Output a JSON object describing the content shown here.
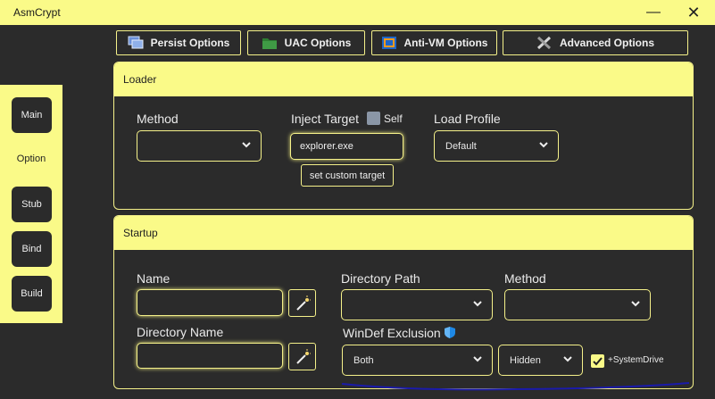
{
  "window": {
    "title": "AsmCrypt",
    "minimize_glyph": "—",
    "close_glyph": "✕"
  },
  "top_tabs": [
    {
      "label": "Persist Options",
      "icon": "window-stack-icon"
    },
    {
      "label": "UAC Options",
      "icon": "green-folder-icon"
    },
    {
      "label": "Anti-VM Options",
      "icon": "vm-box-icon"
    },
    {
      "label": "Advanced Options",
      "icon": "tools-icon"
    }
  ],
  "sidebar": {
    "main": "Main",
    "option": "Option",
    "stub": "Stub",
    "bind": "Bind",
    "build": "Build"
  },
  "loader": {
    "header": "Loader",
    "method_label": "Method",
    "method_value": "",
    "inject_label": "Inject Target",
    "self_label": "Self",
    "self_checked": false,
    "inject_value": "explorer.exe",
    "custom_target_button": "set custom target",
    "profile_label": "Load Profile",
    "profile_value": "Default"
  },
  "startup": {
    "header": "Startup",
    "name_label": "Name",
    "name_value": "",
    "dir_name_label": "Directory Name",
    "dir_name_value": "",
    "dir_path_label": "Directory Path",
    "dir_path_value": "",
    "method_label": "Method",
    "method_value": "",
    "windef_label": "WinDef Exclusion",
    "windef_value": "Both",
    "visibility_value": "Hidden",
    "systemdrive_label": "+SystemDrive",
    "systemdrive_checked": true
  },
  "colors": {
    "accent": "#fafa88",
    "background": "#2b2b2b",
    "text": "#f0f0f0",
    "annotation": "#1a1aaa"
  }
}
